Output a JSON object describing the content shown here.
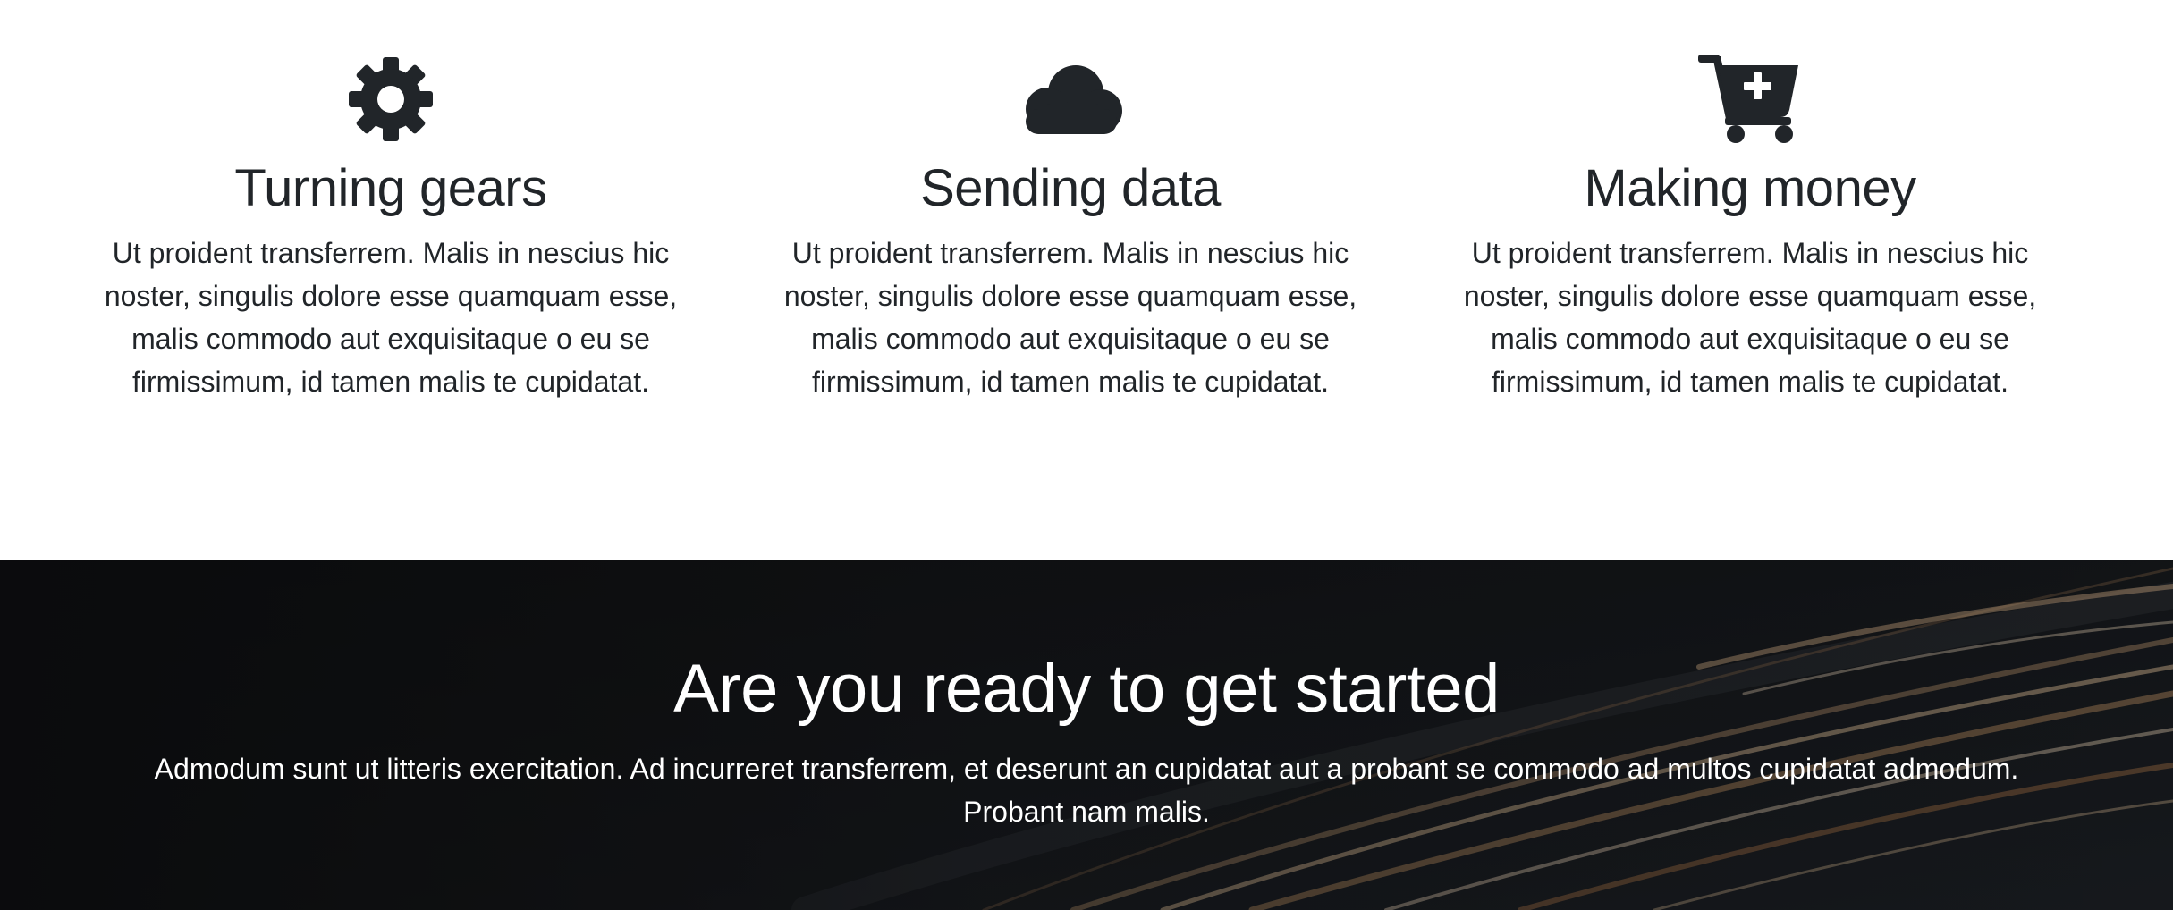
{
  "features": [
    {
      "icon": "gear-icon",
      "title": "Turning gears",
      "text": "Ut proident transferrem. Malis in nescius hic noster, singulis dolore esse quamquam esse, malis commodo aut exquisitaque o eu se firmissimum, id tamen malis te cupidatat."
    },
    {
      "icon": "cloud-icon",
      "title": "Sending data",
      "text": "Ut proident transferrem. Malis in nescius hic noster, singulis dolore esse quamquam esse, malis commodo aut exquisitaque o eu se firmissimum, id tamen malis te cupidatat."
    },
    {
      "icon": "cart-plus-icon",
      "title": "Making money",
      "text": "Ut proident transferrem. Malis in nescius hic noster, singulis dolore esse quamquam esse, malis commodo aut exquisitaque o eu se firmissimum, id tamen malis te cupidatat."
    }
  ],
  "cta": {
    "title": "Are you ready to get started",
    "text": "Admodum sunt ut litteris exercitation. Ad incurreret transferrem, et deserunt an cupidatat aut a probant se commodo ad multos cupidatat admodum. Probant nam malis."
  },
  "colors": {
    "text": "#212529",
    "icon": "#212529",
    "cta_background": "#111214",
    "cta_text": "#ffffff",
    "light_trail": "#e8b27a"
  }
}
